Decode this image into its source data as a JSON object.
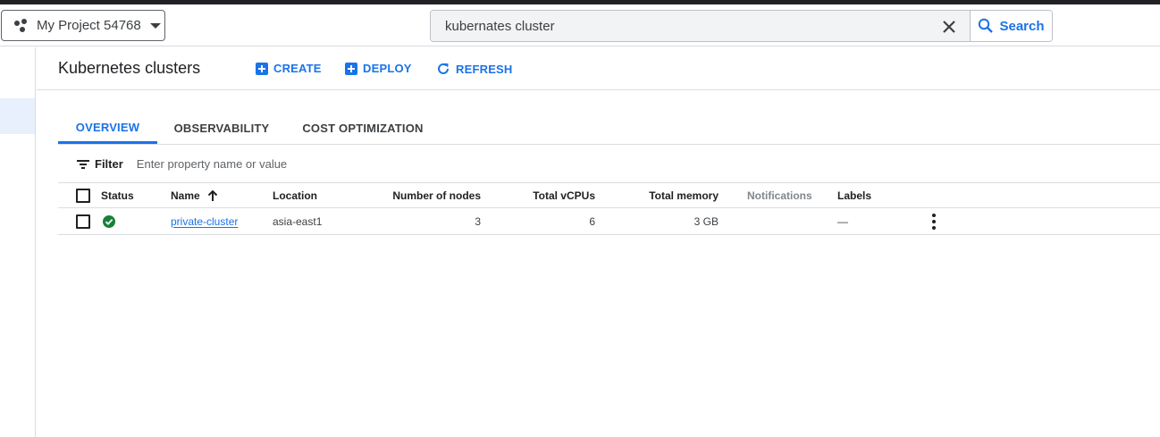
{
  "topbar": {
    "project_name": "My Project 54768",
    "search_value": "kubernates cluster",
    "search_label": "Search"
  },
  "header": {
    "title": "Kubernetes clusters",
    "actions": {
      "create": "CREATE",
      "deploy": "DEPLOY",
      "refresh": "REFRESH"
    }
  },
  "tabs": [
    {
      "label": "OVERVIEW",
      "active": true
    },
    {
      "label": "OBSERVABILITY",
      "active": false
    },
    {
      "label": "COST OPTIMIZATION",
      "active": false
    }
  ],
  "filter": {
    "label": "Filter",
    "placeholder": "Enter property name or value"
  },
  "table": {
    "columns": {
      "status": "Status",
      "name": "Name",
      "location": "Location",
      "nodes": "Number of nodes",
      "vcpus": "Total vCPUs",
      "memory": "Total memory",
      "notifications": "Notifications",
      "labels": "Labels"
    },
    "sort": {
      "column": "name",
      "direction": "ascending"
    },
    "rows": [
      {
        "status": "ok",
        "name": "private-cluster",
        "location": "asia-east1",
        "nodes": "3",
        "vcpus": "6",
        "memory": "3 GB",
        "notifications": "",
        "labels": "—"
      }
    ]
  },
  "colors": {
    "accent": "#1a73e8",
    "status_ok": "#188038",
    "nav_selected": "#e8f0fe"
  },
  "icons": [
    "project-dots-icon",
    "caret-down-icon",
    "clear-icon",
    "search-icon",
    "create-plus-icon",
    "deploy-plus-icon",
    "refresh-icon",
    "filter-icon",
    "sort-arrow-up-icon",
    "check-circle-icon",
    "more-vert-icon"
  ]
}
